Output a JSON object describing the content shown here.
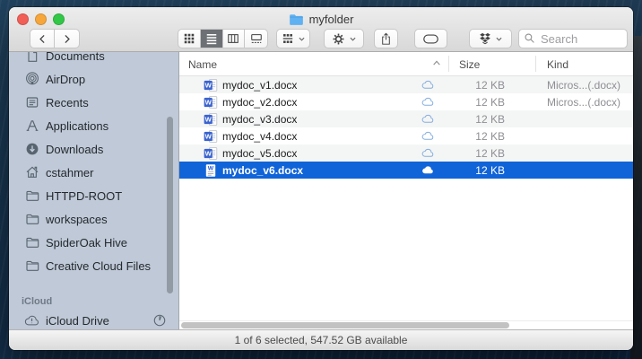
{
  "window": {
    "title": "myfolder"
  },
  "toolbar": {
    "search_placeholder": "Search",
    "icons": [
      "back-icon",
      "forward-icon",
      "grid-view-icon",
      "list-view-icon",
      "column-view-icon",
      "coverflow-view-icon",
      "group-icon",
      "gear-icon",
      "share-icon",
      "tag-icon",
      "dropbox-icon",
      "search-icon",
      "chevron-down-icon"
    ],
    "selected_view": "list"
  },
  "sidebar": {
    "items": [
      {
        "label": "Documents",
        "icon": "document-icon"
      },
      {
        "label": "AirDrop",
        "icon": "airdrop-icon"
      },
      {
        "label": "Recents",
        "icon": "recents-icon"
      },
      {
        "label": "Applications",
        "icon": "applications-icon"
      },
      {
        "label": "Downloads",
        "icon": "downloads-icon"
      },
      {
        "label": "cstahmer",
        "icon": "home-icon"
      },
      {
        "label": "HTTPD-ROOT",
        "icon": "folder-icon"
      },
      {
        "label": "workspaces",
        "icon": "folder-icon"
      },
      {
        "label": "SpiderOak Hive",
        "icon": "folder-icon"
      },
      {
        "label": "Creative Cloud Files",
        "icon": "folder-icon"
      }
    ],
    "icloud_section_label": "iCloud",
    "icloud_item": {
      "label": "iCloud Drive",
      "icon": "icloud-alert-icon",
      "status_icon": "progress-circle-icon"
    }
  },
  "file_list": {
    "columns": [
      "Name",
      "Size",
      "Kind"
    ],
    "sort_column": "Name",
    "sort_direction": "ascending",
    "rows": [
      {
        "name": "mydoc_v1.docx",
        "size": "12 KB",
        "kind": "Micros...(.docx)",
        "cloud": "outline",
        "selected": false
      },
      {
        "name": "mydoc_v2.docx",
        "size": "12 KB",
        "kind": "Micros...(.docx)",
        "cloud": "outline",
        "selected": false
      },
      {
        "name": "mydoc_v3.docx",
        "size": "12 KB",
        "kind": "",
        "cloud": "outline",
        "selected": false
      },
      {
        "name": "mydoc_v4.docx",
        "size": "12 KB",
        "kind": "",
        "cloud": "outline",
        "selected": false
      },
      {
        "name": "mydoc_v5.docx",
        "size": "12 KB",
        "kind": "",
        "cloud": "outline",
        "selected": false
      },
      {
        "name": "mydoc_v6.docx",
        "size": "12 KB",
        "kind": "",
        "cloud": "filled",
        "selected": true
      }
    ]
  },
  "status_bar": {
    "text": "1 of 6 selected, 547.52 GB available"
  },
  "colors": {
    "selection_blue": "#1164d8",
    "folder_blue": "#5fb1f2",
    "traffic_red": "#f15f57",
    "traffic_yellow": "#f6a63a",
    "traffic_green": "#33c748"
  }
}
